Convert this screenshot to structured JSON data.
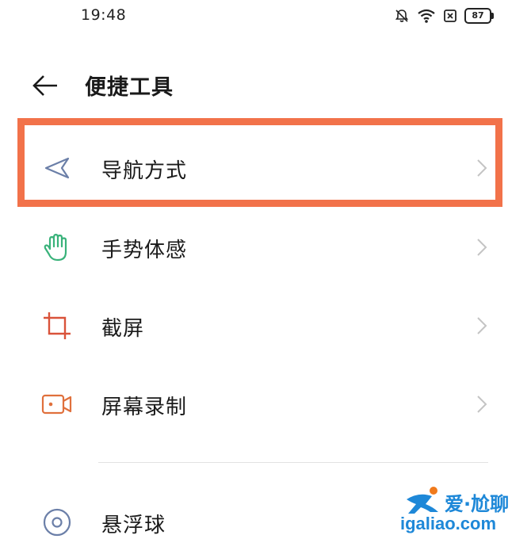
{
  "status_bar": {
    "time": "19:48",
    "battery": "87"
  },
  "header": {
    "title": "便捷工具"
  },
  "menu": [
    {
      "label": "导航方式",
      "icon": "navigation-arrow-icon"
    },
    {
      "label": "手势体感",
      "icon": "hand-gesture-icon"
    },
    {
      "label": "截屏",
      "icon": "crop-screenshot-icon"
    },
    {
      "label": "屏幕录制",
      "icon": "screen-record-icon"
    },
    {
      "label": "悬浮球",
      "icon": "floating-ball-icon"
    }
  ],
  "watermark": {
    "text": "爱·尬聊",
    "url": "igaliao.com"
  },
  "colors": {
    "highlight": "#f2724a",
    "nav_icon": "#6b7fa8",
    "gesture_icon": "#39b27a",
    "screenshot_icon": "#d9533a",
    "record_icon": "#e0703c",
    "ball_icon": "#6b7fa8"
  }
}
